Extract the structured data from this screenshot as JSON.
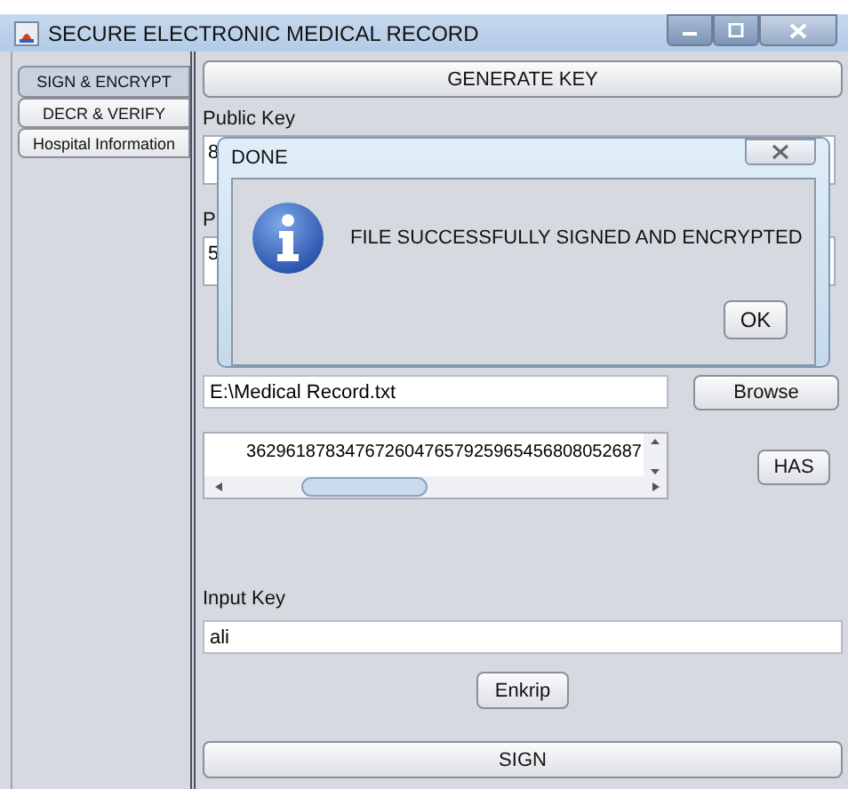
{
  "window": {
    "title": "SECURE ELECTRONIC MEDICAL RECORD"
  },
  "tabs": [
    {
      "label": "SIGN & ENCRYPT",
      "selected": true
    },
    {
      "label": "DECR & VERIFY",
      "selected": false
    },
    {
      "label": "Hospital Information",
      "selected": false
    }
  ],
  "generate_button": "GENERATE KEY",
  "public_key": {
    "label": "Public Key",
    "value": "8"
  },
  "private_key": {
    "label": "P",
    "value": "5"
  },
  "file_field": {
    "value": "E:\\Medical Record.txt"
  },
  "browse_button": "Browse",
  "hash_area": {
    "value": "3629618783476726047657925965456808052687"
  },
  "has_button": "HAS",
  "input_key": {
    "label": "Input Key",
    "value": "ali"
  },
  "enkrip_button": "Enkrip",
  "sign_button": "SIGN",
  "dialog": {
    "title": "DONE",
    "message": "FILE SUCCESSFULLY SIGNED AND ENCRYPTED",
    "ok_button": "OK"
  }
}
